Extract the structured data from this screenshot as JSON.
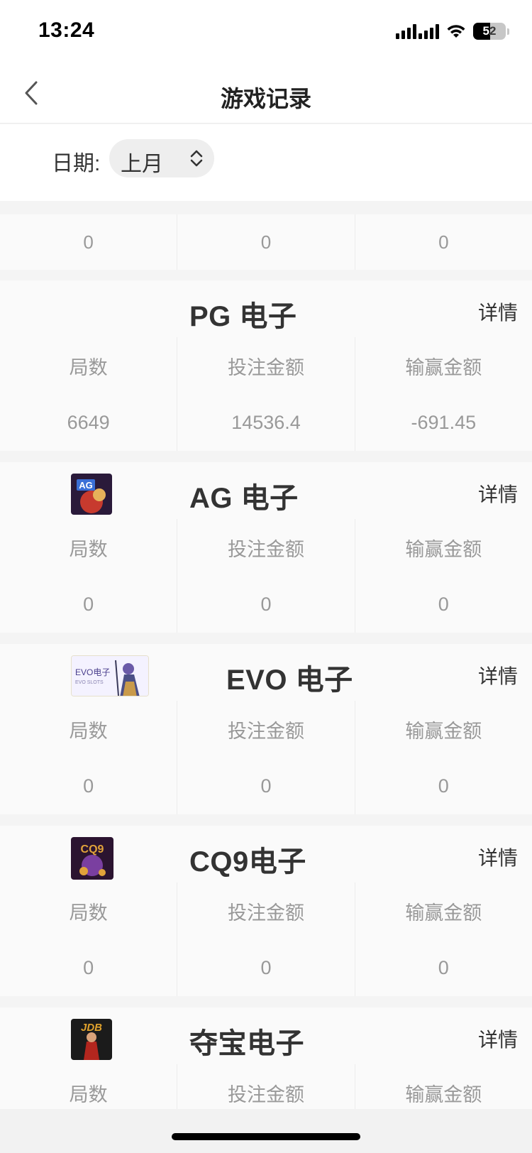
{
  "status_bar": {
    "time": "13:24",
    "battery": "52"
  },
  "header": {
    "title": "游戏记录"
  },
  "filter": {
    "label": "日期:",
    "selected": "上月"
  },
  "top_stats": [
    "0",
    "0",
    "0"
  ],
  "columns": {
    "rounds": "局数",
    "bet": "投注金额",
    "winloss": "输赢金额"
  },
  "detail_label": "详情",
  "cards": [
    {
      "title": "PG 电子",
      "rounds": "6649",
      "bet": "14536.4",
      "winloss": "-691.45"
    },
    {
      "title": "AG 电子",
      "rounds": "0",
      "bet": "0",
      "winloss": "0",
      "logo": {
        "text": "AG",
        "colors": [
          "#2a1a3a",
          "#c73a2e"
        ]
      }
    },
    {
      "title": "EVO 电子",
      "rounds": "0",
      "bet": "0",
      "winloss": "0",
      "logo": {
        "text": "EVO电子",
        "subtext": "EVO SLOTS",
        "colors": [
          "#f4f2ff",
          "#6a5aa8"
        ]
      }
    },
    {
      "title": "CQ9电子",
      "rounds": "0",
      "bet": "0",
      "winloss": "0",
      "logo": {
        "text": "CQ9",
        "colors": [
          "#2b1430",
          "#e1a33a"
        ]
      }
    },
    {
      "title": "夺宝电子",
      "rounds": "",
      "bet": "",
      "winloss": "",
      "logo": {
        "text": "JDB",
        "colors": [
          "#1b1b1b",
          "#e0a22c"
        ]
      }
    }
  ]
}
